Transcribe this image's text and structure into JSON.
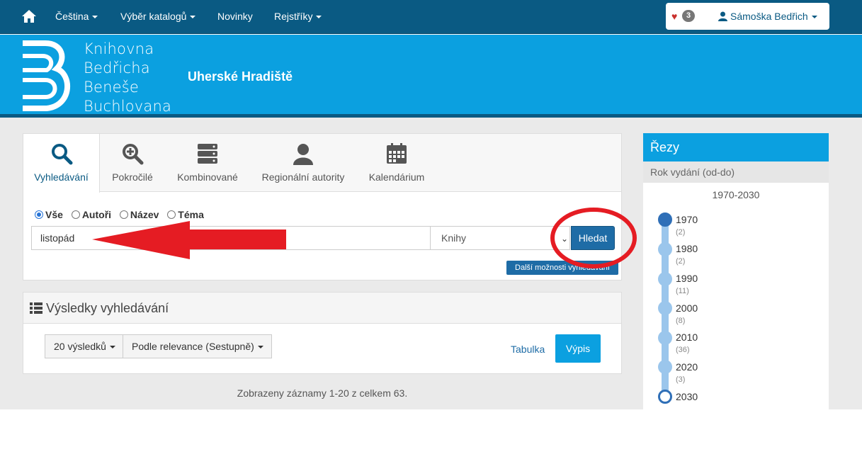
{
  "topnav": {
    "items": [
      {
        "label": "Čeština",
        "dropdown": true
      },
      {
        "label": "Výběr katalogů",
        "dropdown": true
      },
      {
        "label": "Novinky",
        "dropdown": false
      },
      {
        "label": "Rejstříky",
        "dropdown": true
      }
    ],
    "favorites_count": "3",
    "user_name": "Sámoška Bedřich"
  },
  "banner": {
    "logo_lines": [
      "Knihovna",
      "Bedřicha",
      "Beneše",
      "Buchlovana"
    ],
    "city": "Uherské Hradiště"
  },
  "search": {
    "tabs": [
      {
        "label": "Vyhledávání",
        "icon": "search-icon",
        "active": true
      },
      {
        "label": "Pokročilé",
        "icon": "zoom-plus-icon",
        "active": false
      },
      {
        "label": "Kombinované",
        "icon": "server-stack-icon",
        "active": false
      },
      {
        "label": "Regionální autority",
        "icon": "person-icon",
        "active": false
      },
      {
        "label": "Kalendárium",
        "icon": "calendar-icon",
        "active": false
      }
    ],
    "scopes": [
      {
        "label": "Vše",
        "checked": true
      },
      {
        "label": "Autoři",
        "checked": false
      },
      {
        "label": "Název",
        "checked": false
      },
      {
        "label": "Téma",
        "checked": false
      }
    ],
    "query": "listopád",
    "type_selected": "Knihy",
    "submit_label": "Hledat",
    "more_options_label": "Další možnosti vyhledávání"
  },
  "results": {
    "title": "Výsledky vyhledávání",
    "per_page": "20 výsledků",
    "sort": "Podle relevance (Sestupně)",
    "view_table": "Tabulka",
    "view_list": "Výpis",
    "summary": "Zobrazeny záznamy 1-20 z celkem 63."
  },
  "facets": {
    "title": "Řezy",
    "group": "Rok vydání (od-do)",
    "range": "1970-2030",
    "ticks": [
      {
        "year": "1970",
        "count": "(2)"
      },
      {
        "year": "1980",
        "count": "(2)"
      },
      {
        "year": "1990",
        "count": "(11)"
      },
      {
        "year": "2000",
        "count": "(8)"
      },
      {
        "year": "2010",
        "count": "(36)"
      },
      {
        "year": "2020",
        "count": "(3)"
      },
      {
        "year": "2030",
        "count": ""
      }
    ]
  },
  "colors": {
    "nav": "#0a5a83",
    "banner": "#0ba0e0",
    "button": "#1e6ca6",
    "annotation_red": "#e51c23"
  }
}
